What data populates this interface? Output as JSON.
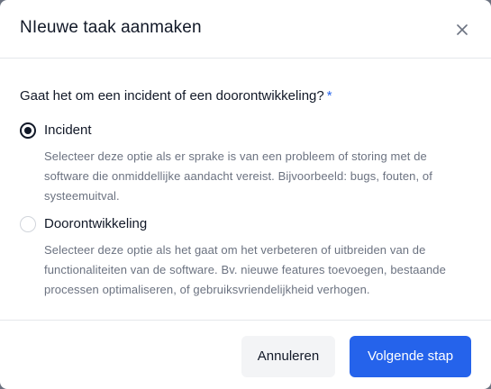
{
  "dialog": {
    "title": "NIeuwe taak aanmaken",
    "close_icon": "close-icon"
  },
  "form": {
    "question": "Gaat het om een incident of een doorontwikkeling?",
    "required_marker": "*",
    "options": [
      {
        "label": "Incident",
        "description": "Selecteer deze optie als er sprake is van een probleem of storing met de software die onmiddellijke aandacht vereist. Bijvoorbeeld: bugs, fouten, of systeemuitval.",
        "selected": true
      },
      {
        "label": "Doorontwikkeling",
        "description": "Selecteer deze optie als het gaat om het verbeteren of uitbreiden van de functionaliteiten van de software. Bv. nieuwe features toevoegen, bestaande processen optimaliseren, of gebruiksvriendelijkheid verhogen.",
        "selected": false
      }
    ]
  },
  "footer": {
    "cancel_label": "Annuleren",
    "next_label": "Volgende stap"
  },
  "colors": {
    "primary": "#2563eb",
    "text": "#111827",
    "muted": "#6b7280",
    "border": "#e5e7eb",
    "secondary_button": "#f3f4f6"
  }
}
